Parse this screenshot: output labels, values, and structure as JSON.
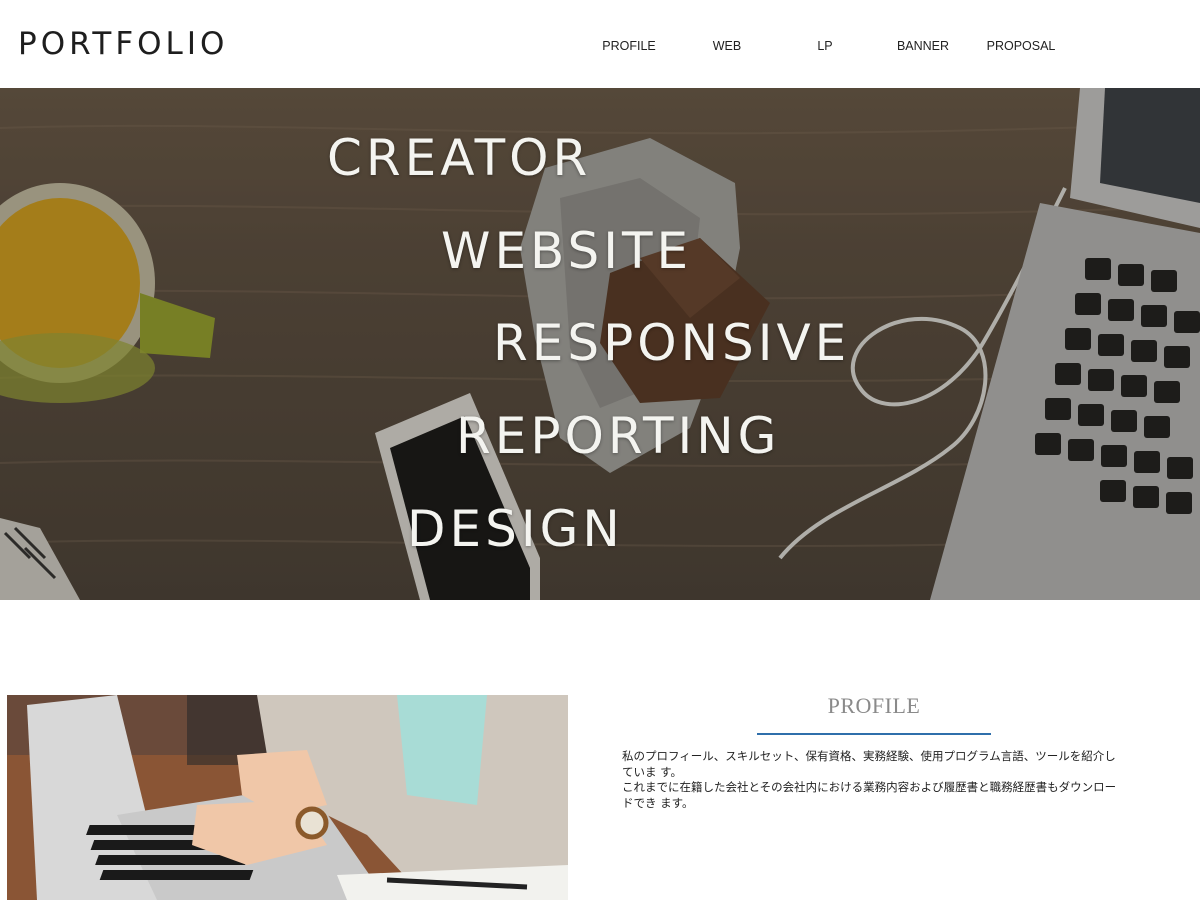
{
  "header": {
    "logo": "PORTFOLIO",
    "nav": [
      "PROFILE",
      "WEB",
      "LP",
      "BANNER",
      "PROPOSAL"
    ]
  },
  "hero": {
    "words": [
      "CREATOR",
      "WEBSITE",
      "RESPONSIVE",
      "REPORTING",
      "DESIGN"
    ]
  },
  "profile": {
    "title": "PROFILE",
    "paragraph1": "私のプロフィール、スキルセット、保有資格、実務経験、使用プログラム言語、ツールを紹介していま す。",
    "paragraph2": "これまでに在籍した会社とその会社内における業務内容および履歴書と職務経歴書もダウンロードでき ます。"
  },
  "colors": {
    "accent_rule": "#2f6fab",
    "title_gray": "#8a8a8a"
  }
}
